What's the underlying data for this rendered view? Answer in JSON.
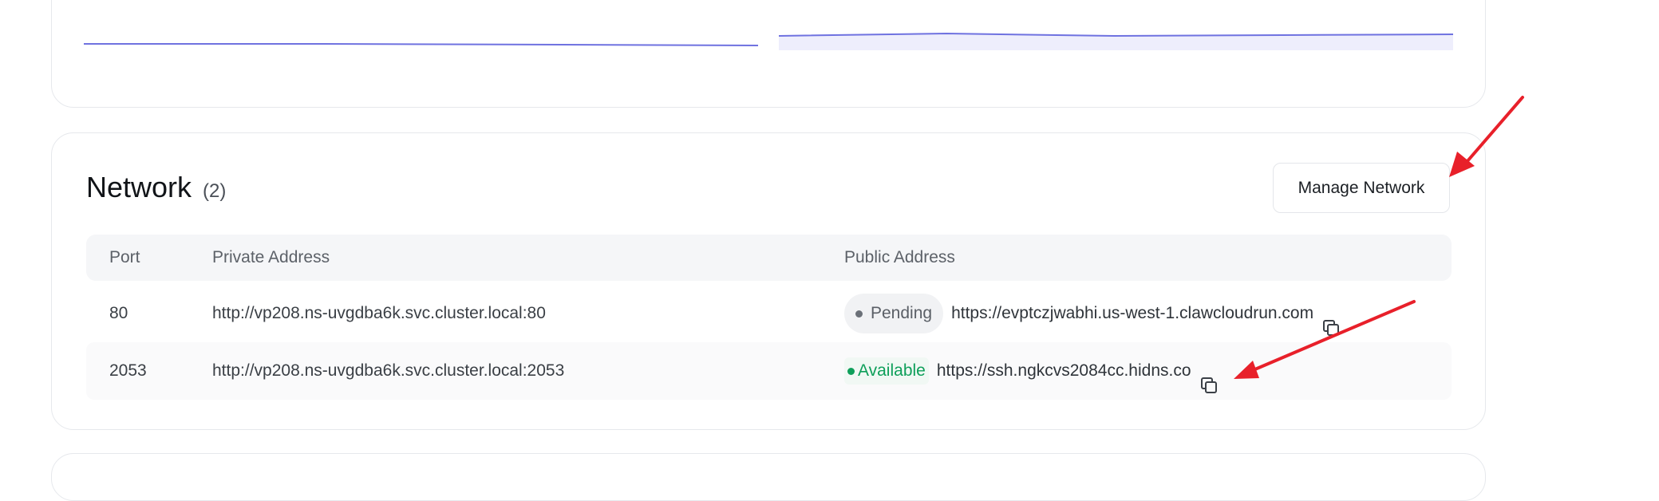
{
  "network": {
    "title": "Network",
    "count": "(2)",
    "manage_label": "Manage Network",
    "headers": {
      "port": "Port",
      "private": "Private Address",
      "public": "Public Address"
    },
    "rows": [
      {
        "port": "80",
        "private": "http://vp208.ns-uvgdba6k.svc.cluster.local:80",
        "status": "Pending",
        "public": "https://evptczjwabhi.us-west-1.clawcloudrun.com"
      },
      {
        "port": "2053",
        "private": "http://vp208.ns-uvgdba6k.svc.cluster.local:2053",
        "status": "Available",
        "public": "https://ssh.ngkcvs2084cc.hidns.co"
      }
    ]
  },
  "colors": {
    "pending_dot": "#6b7078",
    "available": "#0e9f5a",
    "chart_line": "#6f72e0",
    "annotation_arrow": "#e8202a"
  },
  "icons": [
    "copy-icon",
    "arrow-annotation"
  ]
}
